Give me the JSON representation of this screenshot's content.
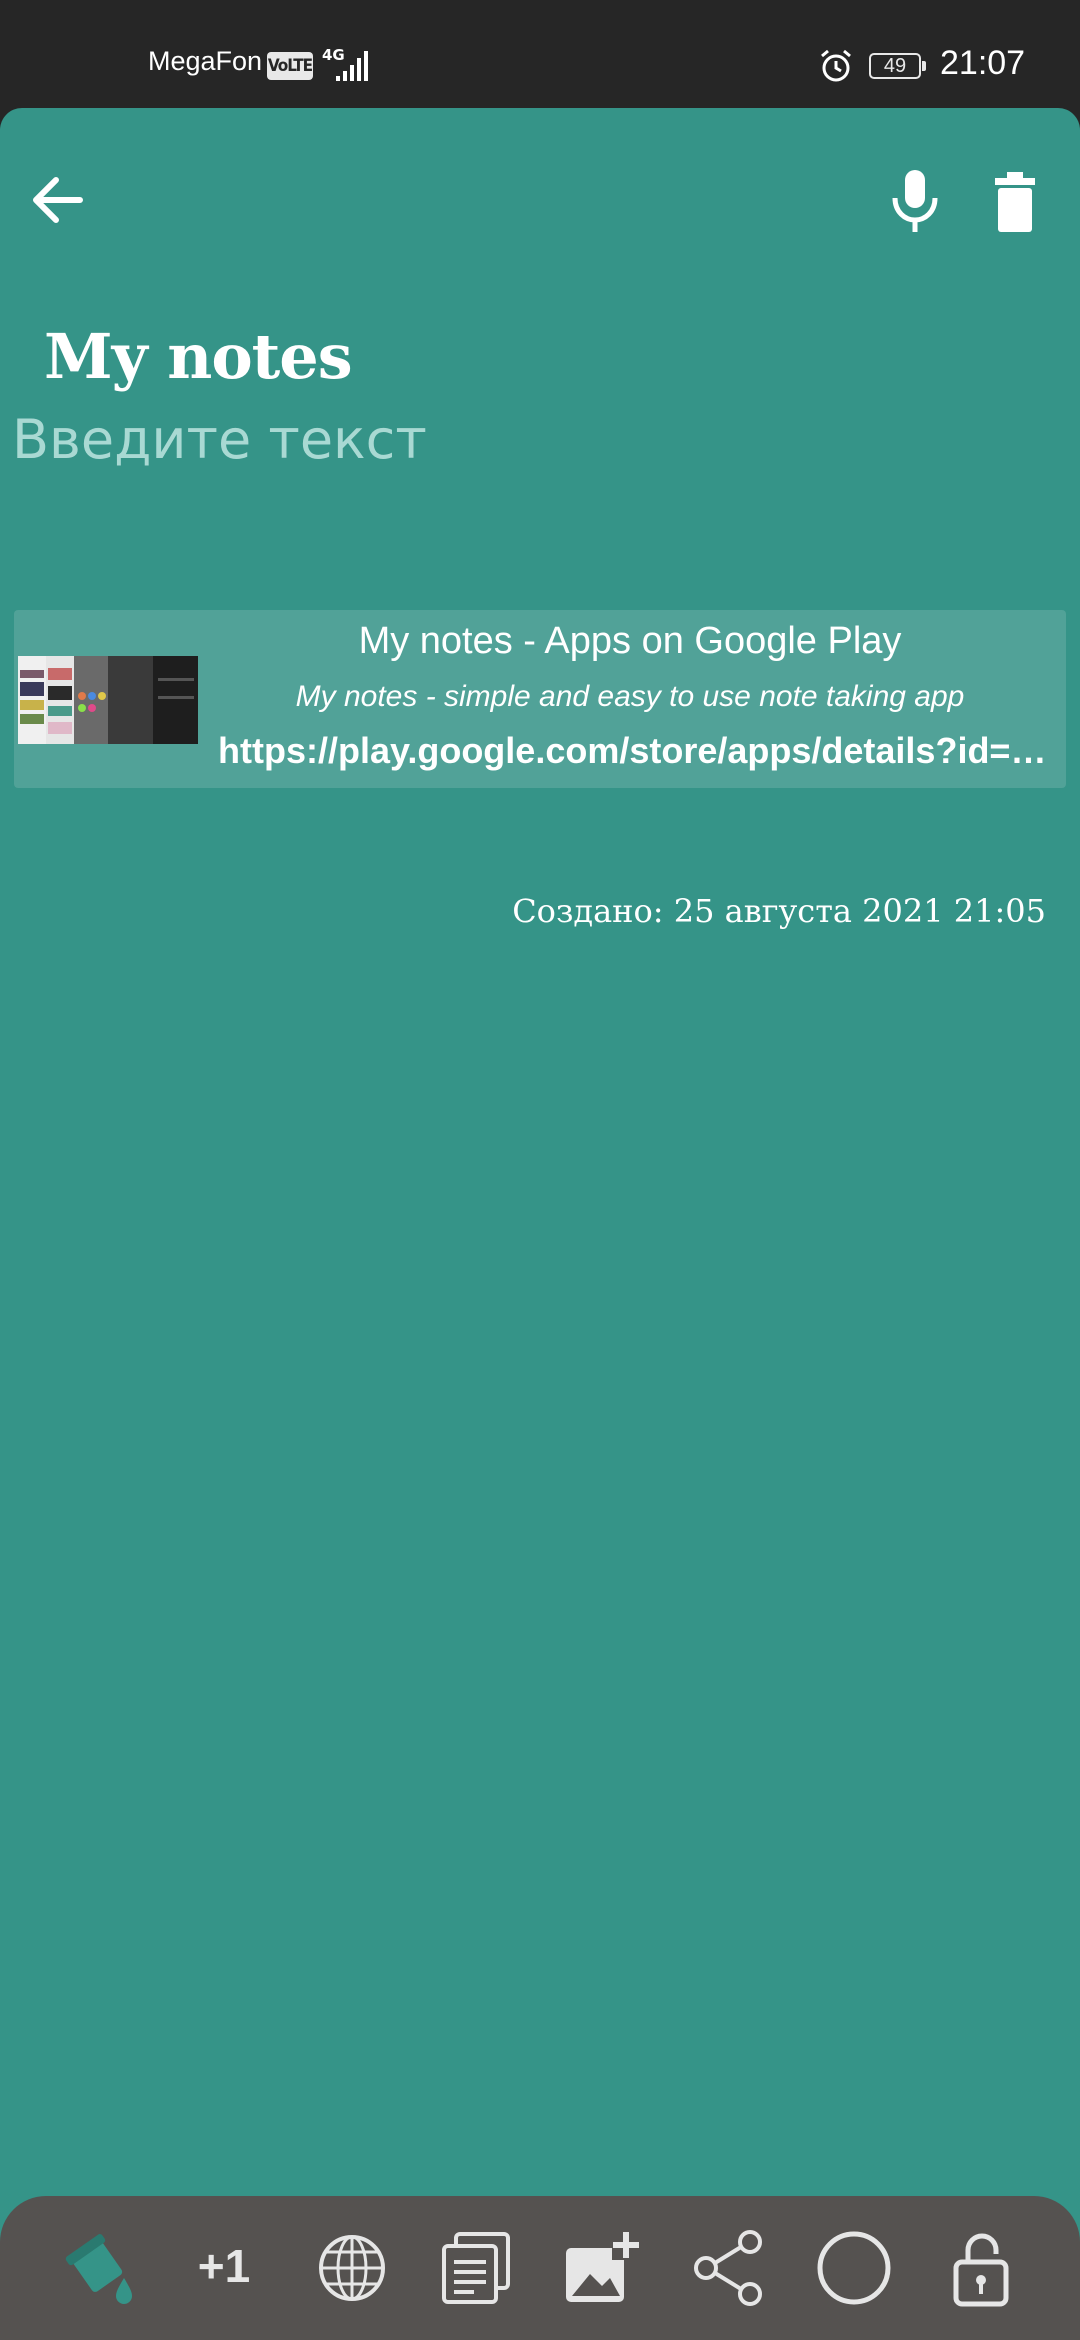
{
  "status_bar": {
    "carrier": "MegaFon",
    "volte": "VoLTE",
    "network": "4G",
    "battery": "49",
    "time": "21:07"
  },
  "header": {
    "back_icon": "arrow-left-icon",
    "mic_icon": "microphone-icon",
    "delete_icon": "trash-icon"
  },
  "note": {
    "title": "My notes",
    "input_placeholder": "Введите текст",
    "created_label": "Создано: 25 августа 2021 21:05"
  },
  "link_preview": {
    "title": "My notes - Apps on Google Play",
    "description": "My notes - simple and easy to use note taking app",
    "url": "https://play.google.com/store/apps/details?id=com.mynotes"
  },
  "toolbar": {
    "items": [
      {
        "icon": "paint-bucket-icon"
      },
      {
        "label": "+1"
      },
      {
        "icon": "globe-icon"
      },
      {
        "icon": "copy-document-icon"
      },
      {
        "icon": "add-image-icon"
      },
      {
        "icon": "share-icon"
      },
      {
        "icon": "circle-icon"
      },
      {
        "icon": "unlock-icon"
      }
    ]
  },
  "colors": {
    "note_background": "#359488",
    "toolbar_background": "#555250",
    "accent": "#359488"
  }
}
